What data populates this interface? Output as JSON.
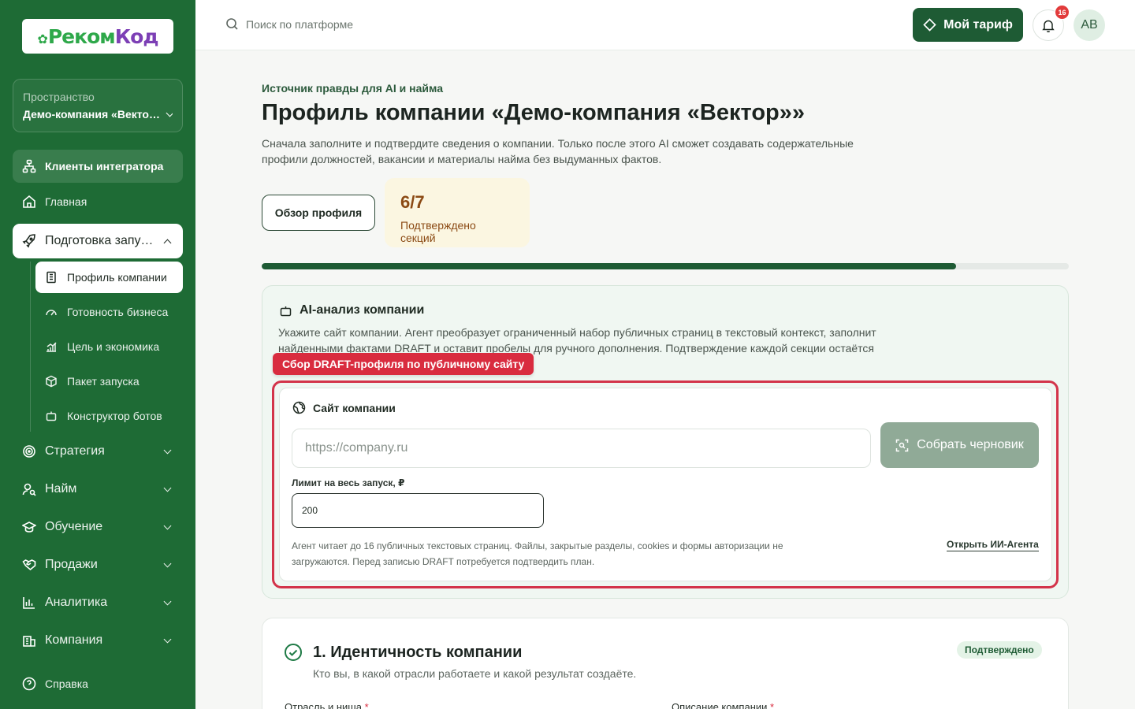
{
  "brand": {
    "logo_text_main": "Реком",
    "logo_text_accent": "Код"
  },
  "sidebar": {
    "space_label": "Пространство",
    "space_name": "Демо-компания «Вектор»",
    "clients": "Клиенты интегратора",
    "home": "Главная",
    "prep": "Подготовка запуска",
    "sub_items": [
      {
        "label": "Профиль компании",
        "icon": "building-icon"
      },
      {
        "label": "Готовность бизнеса",
        "icon": "gauge-icon"
      },
      {
        "label": "Цель и экономика",
        "icon": "chart-growth-icon"
      },
      {
        "label": "Пакет запуска",
        "icon": "package-icon"
      },
      {
        "label": "Конструктор ботов",
        "icon": "bot-icon"
      }
    ],
    "groups": [
      {
        "label": "Стратегия",
        "icon": "target-icon"
      },
      {
        "label": "Найм",
        "icon": "user-search-icon"
      },
      {
        "label": "Обучение",
        "icon": "graduation-cap-icon"
      },
      {
        "label": "Продажи",
        "icon": "handshake-icon"
      },
      {
        "label": "Аналитика",
        "icon": "bar-chart-icon"
      },
      {
        "label": "Компания",
        "icon": "office-icon"
      }
    ],
    "help": "Справка"
  },
  "topbar": {
    "search_placeholder": "Поиск по платформе",
    "tariff_label": "Мой тариф",
    "notifications_count": "16",
    "avatar_initials": "AB"
  },
  "page": {
    "eyebrow": "Источник правды для AI и найма",
    "title": "Профиль компании «Демо-компания «Вектор»»",
    "description": "Сначала заполните и подтвердите сведения о компании. Только после этого AI сможет создавать содержательные профили должностей, вакансии и материалы найма без выдуманных фактов.",
    "overview_button": "Обзор профиля",
    "stat_value": "6/7",
    "stat_label": "Подтверждено секций",
    "progress": 0.86
  },
  "ai_card": {
    "title": "AI-анализ компании",
    "description": "Укажите сайт компании. Агент преобразует ограниченный набор публичных страниц в текстовый контекст, заполнит найденными фактами DRAFT и оставит пробелы для ручного дополнения. Подтверждение каждой секции остаётся",
    "highlight_tag": "Сбор DRAFT-профиля по публичному сайту",
    "site_title": "Сайт компании",
    "url_placeholder": "https://company.ru",
    "url_value": "",
    "collect_button": "Собрать черновик",
    "limit_label": "Лимит на весь запуск, ₽",
    "limit_value": "200",
    "hint": "Агент читает до 16 публичных текстовых страниц. Файлы, закрытые разделы, cookies и формы авторизации не загружаются. Перед записью DRAFT потребуется подтвердить план.",
    "open_agent_link": "Открыть ИИ-Агента"
  },
  "section1": {
    "title": "1. Идентичность компании",
    "subtitle": "Кто вы, в какой отрасли работаете и какой результат создаёте.",
    "badge": "Подтверждено",
    "field1_label": "Отрасль и ниша",
    "field2_label": "Описание компании"
  },
  "colors": {
    "sidebar": "#1e6b35",
    "accent": "#1e5b34",
    "highlight_red": "#d92c3f",
    "stat_bg": "#fbf6e1"
  }
}
